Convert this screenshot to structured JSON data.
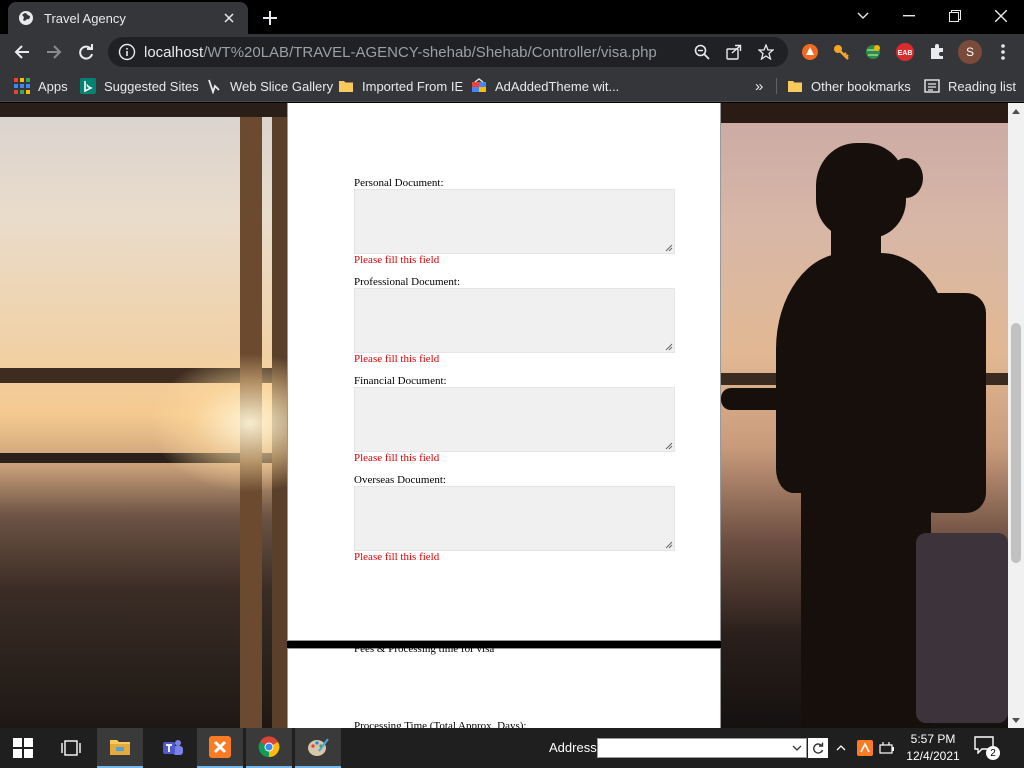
{
  "browser": {
    "tab": {
      "title": "Travel Agency"
    },
    "address": {
      "host": "localhost",
      "path": "/WT%20LAB/TRAVEL-AGENCY-shehab/Shehab/Controller/visa.php"
    },
    "profile_initial": "S",
    "bookmarks": [
      {
        "label": "Apps",
        "icon": "apps-grid-icon"
      },
      {
        "label": "Suggested Sites",
        "icon": "bing-icon"
      },
      {
        "label": "Web Slice Gallery",
        "icon": "web-slice-icon"
      },
      {
        "label": "Imported From IE",
        "icon": "folder-icon"
      },
      {
        "label": "AdAddedTheme wit...",
        "icon": "theme-icon"
      }
    ],
    "bookmarks_overflow": "»",
    "other_bookmarks": "Other bookmarks",
    "reading_list": "Reading list"
  },
  "form": {
    "fields": [
      {
        "label": "Personal Document:",
        "value": "",
        "error": "Please fill this field"
      },
      {
        "label": "Professional Document:",
        "value": "",
        "error": "Please fill this field"
      },
      {
        "label": "Financial Document:",
        "value": "",
        "error": "Please fill this field"
      },
      {
        "label": "Overseas Document:",
        "value": "",
        "error": "Please fill this field"
      }
    ],
    "next_section": {
      "heading": "Fees & Processing time for visa",
      "processing_label": "Processing Time (Total Approx. Days):"
    }
  },
  "taskbar": {
    "address_label": "Address",
    "time": "5:57 PM",
    "date": "12/4/2021",
    "notifications": "2"
  },
  "colors": {
    "error": "#e00000",
    "chrome_dark": "#35363a",
    "taskbar": "#1f1f1f"
  }
}
